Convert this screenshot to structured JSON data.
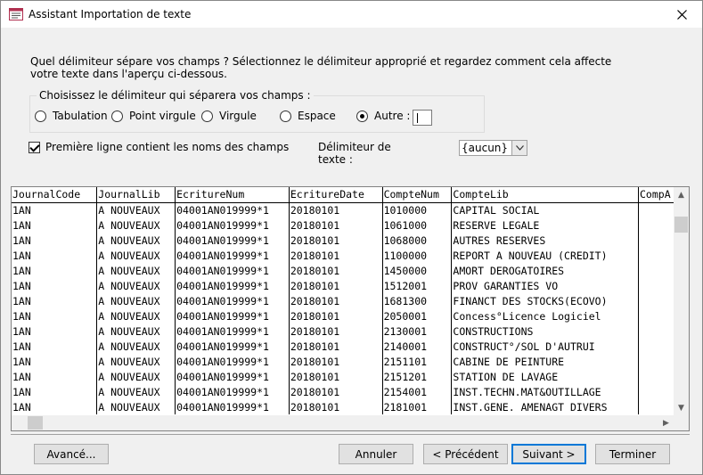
{
  "window": {
    "title": "Assistant Importation de texte"
  },
  "instructions": "Quel délimiteur sépare vos champs ?  Sélectionnez le délimiteur approprié et regardez comment cela affecte votre texte dans l'aperçu ci-dessous.",
  "delimiter_group": {
    "legend": "Choisissez le délimiteur qui séparera vos champs :",
    "options": [
      {
        "label": "Tabulation",
        "checked": false
      },
      {
        "label": "Point virgule",
        "checked": false
      },
      {
        "label": "Virgule",
        "checked": false
      },
      {
        "label": "Espace",
        "checked": false
      },
      {
        "label": "Autre :",
        "checked": true
      }
    ],
    "other_value": ""
  },
  "first_row_checkbox": {
    "label": "Première ligne contient les noms des champs",
    "checked": true
  },
  "text_qualifier": {
    "label": "Délimiteur de texte :",
    "value": "{aucun}"
  },
  "preview": {
    "headers": [
      "JournalCode",
      "JournalLib",
      "EcritureNum",
      "EcritureDate",
      "CompteNum",
      "CompteLib",
      "CompA"
    ],
    "rows": [
      [
        "1AN",
        "A NOUVEAUX",
        "04001AN019999*1",
        "20180101",
        "1010000",
        "CAPITAL SOCIAL",
        ""
      ],
      [
        "1AN",
        "A NOUVEAUX",
        "04001AN019999*1",
        "20180101",
        "1061000",
        "RESERVE LEGALE",
        ""
      ],
      [
        "1AN",
        "A NOUVEAUX",
        "04001AN019999*1",
        "20180101",
        "1068000",
        "AUTRES RESERVES",
        ""
      ],
      [
        "1AN",
        "A NOUVEAUX",
        "04001AN019999*1",
        "20180101",
        "1100000",
        "REPORT A NOUVEAU (CREDIT)",
        ""
      ],
      [
        "1AN",
        "A NOUVEAUX",
        "04001AN019999*1",
        "20180101",
        "1450000",
        "AMORT DEROGATOIRES",
        ""
      ],
      [
        "1AN",
        "A NOUVEAUX",
        "04001AN019999*1",
        "20180101",
        "1512001",
        "PROV GARANTIES VO",
        ""
      ],
      [
        "1AN",
        "A NOUVEAUX",
        "04001AN019999*1",
        "20180101",
        "1681300",
        "FINANCT DES STOCKS(ECOVO)",
        ""
      ],
      [
        "1AN",
        "A NOUVEAUX",
        "04001AN019999*1",
        "20180101",
        "2050001",
        "Concess°Licence Logiciel",
        ""
      ],
      [
        "1AN",
        "A NOUVEAUX",
        "04001AN019999*1",
        "20180101",
        "2130001",
        "CONSTRUCTIONS",
        ""
      ],
      [
        "1AN",
        "A NOUVEAUX",
        "04001AN019999*1",
        "20180101",
        "2140001",
        "CONSTRUCT°/SOL D'AUTRUI",
        ""
      ],
      [
        "1AN",
        "A NOUVEAUX",
        "04001AN019999*1",
        "20180101",
        "2151101",
        "CABINE DE PEINTURE",
        ""
      ],
      [
        "1AN",
        "A NOUVEAUX",
        "04001AN019999*1",
        "20180101",
        "2151201",
        "STATION DE LAVAGE",
        ""
      ],
      [
        "1AN",
        "A NOUVEAUX",
        "04001AN019999*1",
        "20180101",
        "2154001",
        "INST.TECHN.MAT&OUTILLAGE",
        ""
      ],
      [
        "1AN",
        "A NOUVEAUX",
        "04001AN019999*1",
        "20180101",
        "2181001",
        "INST.GENE. AMENAGT DIVERS",
        ""
      ]
    ]
  },
  "buttons": {
    "advanced": "Avancé...",
    "cancel": "Annuler",
    "previous": "< Précédent",
    "next": "Suivant >",
    "finish": "Terminer"
  }
}
